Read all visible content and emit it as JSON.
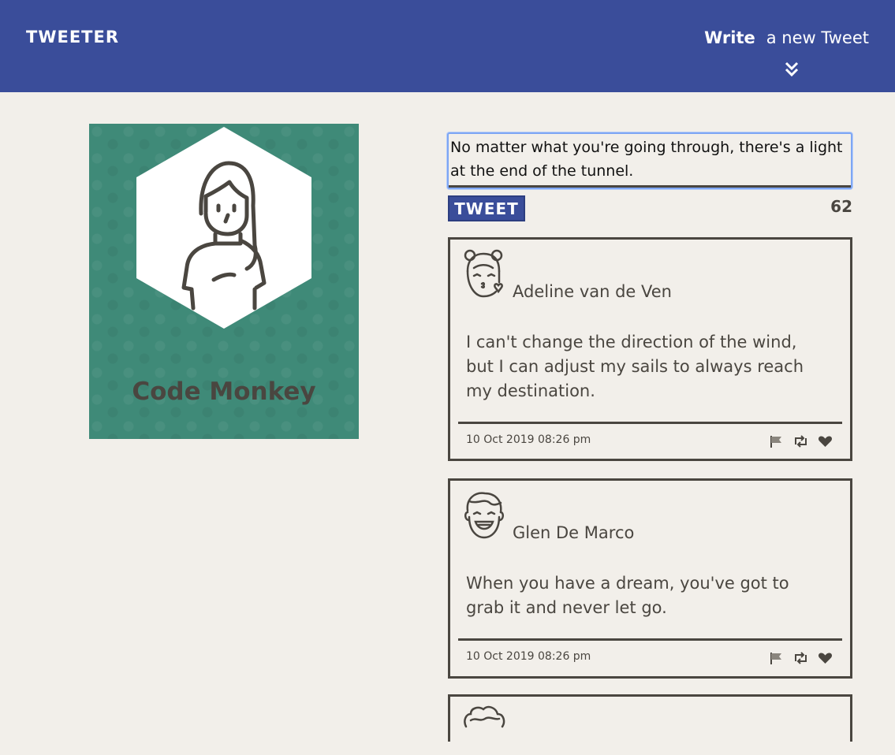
{
  "header": {
    "brand": "TWEETER",
    "write_label": "Write",
    "new_tweet_label": "a new Tweet",
    "toggle_icon": "double-chevron-down-icon"
  },
  "profile": {
    "name": "Code Monkey",
    "avatar_icon": "woman-avatar-icon",
    "card_color": "#3f8a78"
  },
  "composer": {
    "text": "No matter what you're going through, there's a light at the end of the tunnel.",
    "button_label": "TWEET",
    "counter": "62"
  },
  "tweets": [
    {
      "author": "Adeline van de Ven",
      "avatar_icon": "girl-kiss-avatar-icon",
      "text": "I can't change the direction of the wind, but I can adjust my sails to always reach my destination.",
      "timestamp": "10 Oct 2019 08:26 pm"
    },
    {
      "author": "Glen De Marco",
      "avatar_icon": "boy-laughing-avatar-icon",
      "text": "When you have a dream, you've got to grab it and never let go.",
      "timestamp": "10 Oct 2019 08:26 pm"
    }
  ],
  "colors": {
    "nav": "#3a4d9a",
    "background": "#f2efea",
    "text": "#4a4640"
  }
}
